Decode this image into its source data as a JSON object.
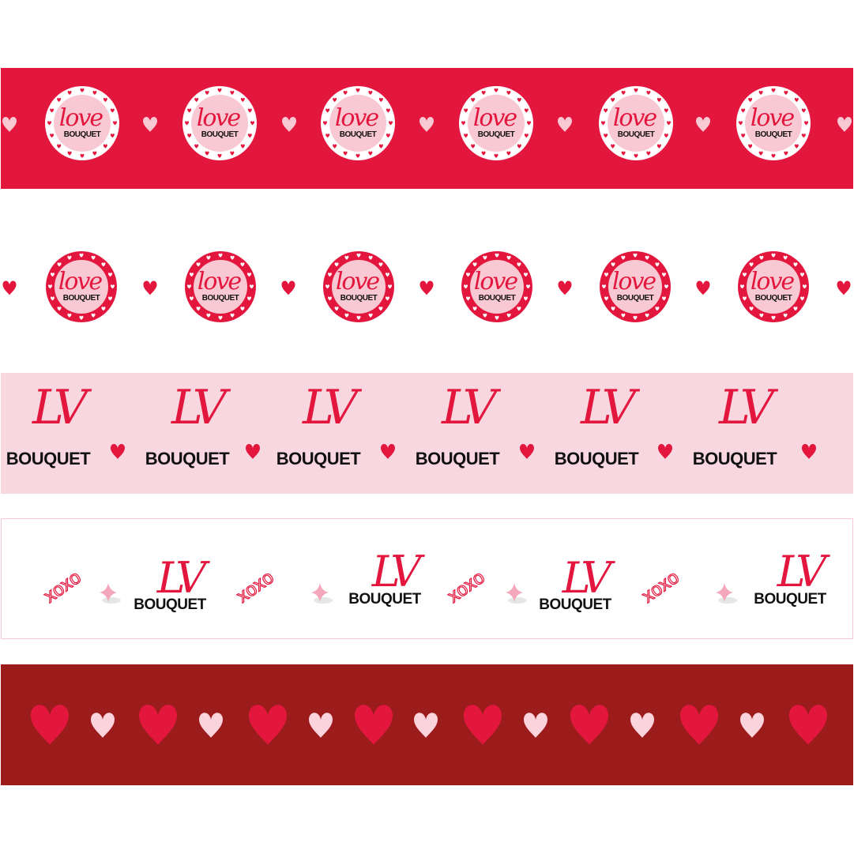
{
  "ribbons": [
    {
      "id": "r1",
      "style": "badge-on-red",
      "background": "#e3173e",
      "badge_ring": "#ffffff",
      "badge_fill": "#f9c9d3",
      "heart_color": "#f9c9d3",
      "script_color": "#e3173e",
      "text_color": "#111111",
      "script_text": "love",
      "brand_text": "BOUQUET",
      "repeat": 6
    },
    {
      "id": "r2",
      "style": "badge-on-white",
      "background": "#ffffff",
      "badge_ring": "#e3173e",
      "badge_fill": "#f9c9d3",
      "heart_color": "#e3173e",
      "script_color": "#e3173e",
      "text_color": "#111111",
      "script_text": "love",
      "brand_text": "BOUQUET",
      "repeat": 6
    },
    {
      "id": "r3",
      "style": "lv-on-pink",
      "background": "#f9d7e1",
      "heart_color": "#e3173e",
      "script_color": "#e3173e",
      "text_color": "#111111",
      "script_text": "LV",
      "brand_text": "BOUQUET",
      "repeat": 6
    },
    {
      "id": "r4",
      "style": "xoxo-on-white",
      "background": "#ffffff",
      "border": "#f6c9d4",
      "xoxo_text": "xoxo",
      "xoxo_color": "#e3173e",
      "sparkle_color": "#f4a7bb",
      "script_color": "#e3173e",
      "text_color": "#111111",
      "script_text": "LV",
      "brand_text": "BOUQUET",
      "repeat": 4
    },
    {
      "id": "r5",
      "style": "hearts-on-maroon",
      "background": "#9c1c1c",
      "big_heart_color": "#e3173e",
      "small_heart_color": "#fbd3dd",
      "repeat": 7
    }
  ]
}
